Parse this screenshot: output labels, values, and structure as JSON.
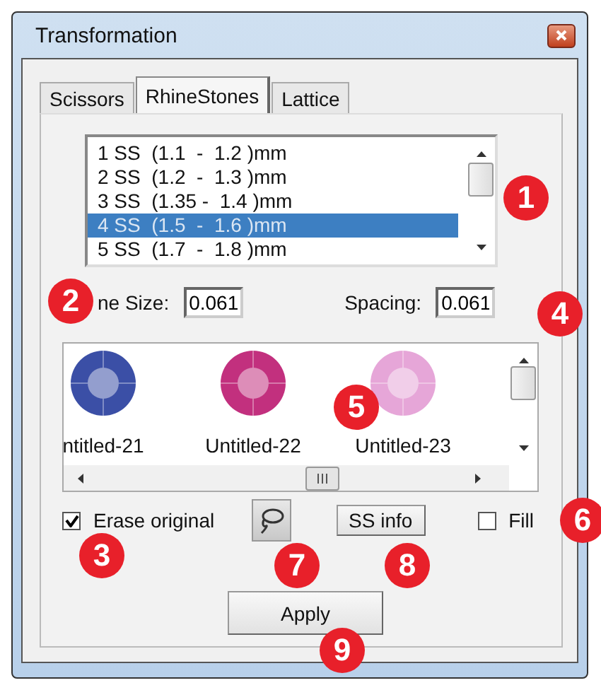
{
  "window": {
    "title": "Transformation"
  },
  "tabs": [
    {
      "label": "Scissors",
      "selected": false
    },
    {
      "label": "RhineStones",
      "selected": true
    },
    {
      "label": "Lattice",
      "selected": false
    }
  ],
  "size_list": {
    "items": [
      {
        "label": "1 SS  (1.1  -  1.2 )mm",
        "selected": false
      },
      {
        "label": "2 SS  (1.2  -  1.3 )mm",
        "selected": false
      },
      {
        "label": "3 SS  (1.35 -  1.4 )mm",
        "selected": false
      },
      {
        "label": "4 SS  (1.5  -  1.6 )mm",
        "selected": true
      },
      {
        "label": "5 SS  (1.7  -  1.8 )mm",
        "selected": false
      }
    ]
  },
  "stone_size": {
    "label": "ne Size:",
    "value": "0.061"
  },
  "spacing": {
    "label": "Spacing:",
    "value": "0.061"
  },
  "gallery": {
    "items": [
      {
        "label": "ntitled-21",
        "color": "#3b4fa6"
      },
      {
        "label": "Untitled-22",
        "color": "#c2307e"
      },
      {
        "label": "Untitled-23",
        "color": "#e6a6d8"
      }
    ]
  },
  "erase_original": {
    "label": "Erase original",
    "checked": true
  },
  "ss_info_button": {
    "label": "SS info"
  },
  "fill": {
    "label": "Fill",
    "checked": false
  },
  "apply_button": {
    "label": "Apply"
  },
  "callouts": [
    {
      "label": "1"
    },
    {
      "label": "2"
    },
    {
      "label": "3"
    },
    {
      "label": "4"
    },
    {
      "label": "5"
    },
    {
      "label": "6"
    },
    {
      "label": "7"
    },
    {
      "label": "8"
    },
    {
      "label": "9"
    }
  ]
}
